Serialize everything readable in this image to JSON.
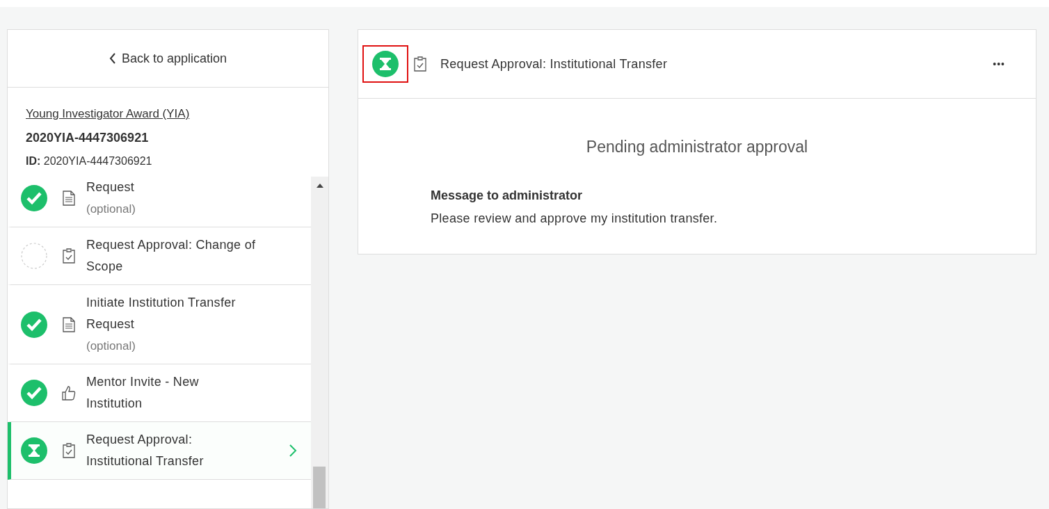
{
  "sidebar": {
    "back_link": "Back to application",
    "award_link": "Young Investigator Award (YIA)",
    "application_number": "2020YIA-4447306921",
    "id_label": "ID:",
    "id_value": "2020YIA-4447306921",
    "items": [
      {
        "title": "Request",
        "note": "(optional)",
        "kind": "complete",
        "selected": false
      },
      {
        "title": "Request Approval: Change of Scope",
        "kind": "not_started",
        "selected": false
      },
      {
        "title": "Initiate Institution Transfer Request",
        "note": "(optional)",
        "kind": "complete",
        "selected": false
      },
      {
        "title": "Mentor Invite - New Institution",
        "kind": "complete",
        "selected": false
      },
      {
        "title": "Request Approval: Institutional Transfer",
        "kind": "pending",
        "selected": true
      }
    ]
  },
  "task": {
    "kind": "pending",
    "status_highlighted": true,
    "title": "Request Approval: Institutional Transfer",
    "more": "•••",
    "state_text": "Pending administrator approval",
    "message_heading": "Message to administrator",
    "message": "Please review and approve my institution transfer."
  }
}
